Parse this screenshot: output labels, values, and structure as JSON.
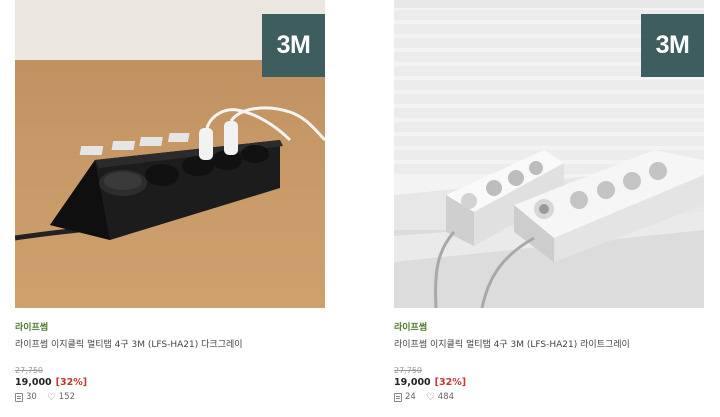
{
  "products": [
    {
      "badge": "3M",
      "brand": "라이프썸",
      "name": "라이프썸 이지클릭 멀티탭 4구 3M (LFS-HA21) 다크그레이",
      "original_price": "27,750",
      "price": "19,000",
      "discount": "[32%]",
      "review_count": "30",
      "like_count": "152",
      "review_icon": "review-icon",
      "like_icon": "heart-icon"
    },
    {
      "badge": "3M",
      "brand": "라이프썸",
      "name": "라이프썸 이지클릭 멀티탭 4구 3M (LFS-HA21) 라이트그레이",
      "original_price": "27,750",
      "price": "19,000",
      "discount": "[32%]",
      "review_count": "24",
      "like_count": "484",
      "review_icon": "review-icon",
      "like_icon": "heart-icon"
    }
  ],
  "colors": {
    "badge": "#3e5d5f",
    "brand": "#4a7a2a",
    "discount": "#c0392b"
  }
}
